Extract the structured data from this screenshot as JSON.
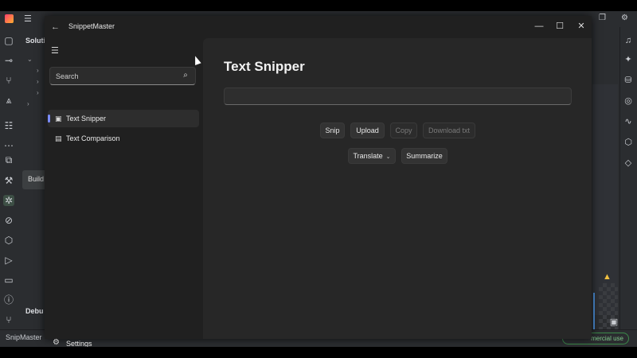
{
  "ide": {
    "panel_label": "Soluti",
    "debug_label": "Debu",
    "tooltip": "Build",
    "status_name": "SnipMaster",
    "license_badge": "mercial use"
  },
  "app": {
    "title": "SnippetMaster",
    "search_placeholder": "Search",
    "nav": [
      {
        "label": "Text Snipper",
        "icon": "snipper-icon",
        "active": true
      },
      {
        "label": "Text Comparison",
        "icon": "comparison-icon",
        "active": false
      }
    ],
    "settings_label": "Settings"
  },
  "page": {
    "title": "Text Snipper",
    "input_value": "",
    "buttons": {
      "snip": "Snip",
      "upload": "Upload",
      "copy": "Copy",
      "download": "Download txt",
      "translate": "Translate",
      "summarize": "Summarize"
    }
  },
  "colors": {
    "accent": "#7a8cff",
    "window_bg": "#202020",
    "content_bg": "#272727"
  }
}
